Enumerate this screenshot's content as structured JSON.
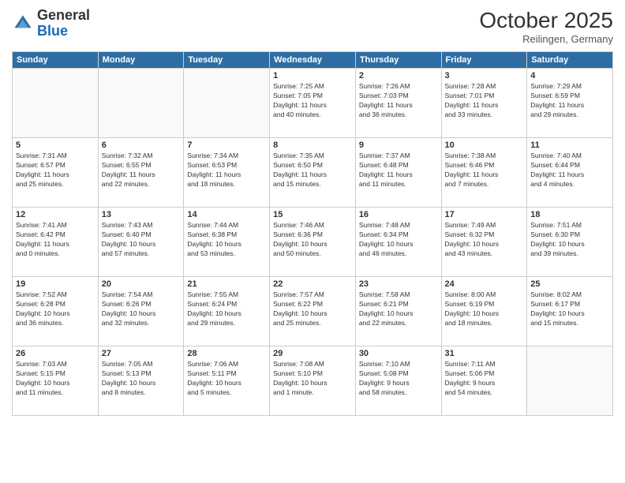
{
  "header": {
    "logo_general": "General",
    "logo_blue": "Blue",
    "month_title": "October 2025",
    "location": "Reilingen, Germany"
  },
  "weekdays": [
    "Sunday",
    "Monday",
    "Tuesday",
    "Wednesday",
    "Thursday",
    "Friday",
    "Saturday"
  ],
  "weeks": [
    [
      {
        "day": "",
        "info": ""
      },
      {
        "day": "",
        "info": ""
      },
      {
        "day": "",
        "info": ""
      },
      {
        "day": "1",
        "info": "Sunrise: 7:25 AM\nSunset: 7:05 PM\nDaylight: 11 hours\nand 40 minutes."
      },
      {
        "day": "2",
        "info": "Sunrise: 7:26 AM\nSunset: 7:03 PM\nDaylight: 11 hours\nand 36 minutes."
      },
      {
        "day": "3",
        "info": "Sunrise: 7:28 AM\nSunset: 7:01 PM\nDaylight: 11 hours\nand 33 minutes."
      },
      {
        "day": "4",
        "info": "Sunrise: 7:29 AM\nSunset: 6:59 PM\nDaylight: 11 hours\nand 29 minutes."
      }
    ],
    [
      {
        "day": "5",
        "info": "Sunrise: 7:31 AM\nSunset: 6:57 PM\nDaylight: 11 hours\nand 25 minutes."
      },
      {
        "day": "6",
        "info": "Sunrise: 7:32 AM\nSunset: 6:55 PM\nDaylight: 11 hours\nand 22 minutes."
      },
      {
        "day": "7",
        "info": "Sunrise: 7:34 AM\nSunset: 6:53 PM\nDaylight: 11 hours\nand 18 minutes."
      },
      {
        "day": "8",
        "info": "Sunrise: 7:35 AM\nSunset: 6:50 PM\nDaylight: 11 hours\nand 15 minutes."
      },
      {
        "day": "9",
        "info": "Sunrise: 7:37 AM\nSunset: 6:48 PM\nDaylight: 11 hours\nand 11 minutes."
      },
      {
        "day": "10",
        "info": "Sunrise: 7:38 AM\nSunset: 6:46 PM\nDaylight: 11 hours\nand 7 minutes."
      },
      {
        "day": "11",
        "info": "Sunrise: 7:40 AM\nSunset: 6:44 PM\nDaylight: 11 hours\nand 4 minutes."
      }
    ],
    [
      {
        "day": "12",
        "info": "Sunrise: 7:41 AM\nSunset: 6:42 PM\nDaylight: 11 hours\nand 0 minutes."
      },
      {
        "day": "13",
        "info": "Sunrise: 7:43 AM\nSunset: 6:40 PM\nDaylight: 10 hours\nand 57 minutes."
      },
      {
        "day": "14",
        "info": "Sunrise: 7:44 AM\nSunset: 6:38 PM\nDaylight: 10 hours\nand 53 minutes."
      },
      {
        "day": "15",
        "info": "Sunrise: 7:46 AM\nSunset: 6:36 PM\nDaylight: 10 hours\nand 50 minutes."
      },
      {
        "day": "16",
        "info": "Sunrise: 7:48 AM\nSunset: 6:34 PM\nDaylight: 10 hours\nand 46 minutes."
      },
      {
        "day": "17",
        "info": "Sunrise: 7:49 AM\nSunset: 6:32 PM\nDaylight: 10 hours\nand 43 minutes."
      },
      {
        "day": "18",
        "info": "Sunrise: 7:51 AM\nSunset: 6:30 PM\nDaylight: 10 hours\nand 39 minutes."
      }
    ],
    [
      {
        "day": "19",
        "info": "Sunrise: 7:52 AM\nSunset: 6:28 PM\nDaylight: 10 hours\nand 36 minutes."
      },
      {
        "day": "20",
        "info": "Sunrise: 7:54 AM\nSunset: 6:26 PM\nDaylight: 10 hours\nand 32 minutes."
      },
      {
        "day": "21",
        "info": "Sunrise: 7:55 AM\nSunset: 6:24 PM\nDaylight: 10 hours\nand 29 minutes."
      },
      {
        "day": "22",
        "info": "Sunrise: 7:57 AM\nSunset: 6:22 PM\nDaylight: 10 hours\nand 25 minutes."
      },
      {
        "day": "23",
        "info": "Sunrise: 7:58 AM\nSunset: 6:21 PM\nDaylight: 10 hours\nand 22 minutes."
      },
      {
        "day": "24",
        "info": "Sunrise: 8:00 AM\nSunset: 6:19 PM\nDaylight: 10 hours\nand 18 minutes."
      },
      {
        "day": "25",
        "info": "Sunrise: 8:02 AM\nSunset: 6:17 PM\nDaylight: 10 hours\nand 15 minutes."
      }
    ],
    [
      {
        "day": "26",
        "info": "Sunrise: 7:03 AM\nSunset: 5:15 PM\nDaylight: 10 hours\nand 11 minutes."
      },
      {
        "day": "27",
        "info": "Sunrise: 7:05 AM\nSunset: 5:13 PM\nDaylight: 10 hours\nand 8 minutes."
      },
      {
        "day": "28",
        "info": "Sunrise: 7:06 AM\nSunset: 5:11 PM\nDaylight: 10 hours\nand 5 minutes."
      },
      {
        "day": "29",
        "info": "Sunrise: 7:08 AM\nSunset: 5:10 PM\nDaylight: 10 hours\nand 1 minute."
      },
      {
        "day": "30",
        "info": "Sunrise: 7:10 AM\nSunset: 5:08 PM\nDaylight: 9 hours\nand 58 minutes."
      },
      {
        "day": "31",
        "info": "Sunrise: 7:11 AM\nSunset: 5:06 PM\nDaylight: 9 hours\nand 54 minutes."
      },
      {
        "day": "",
        "info": ""
      }
    ]
  ]
}
